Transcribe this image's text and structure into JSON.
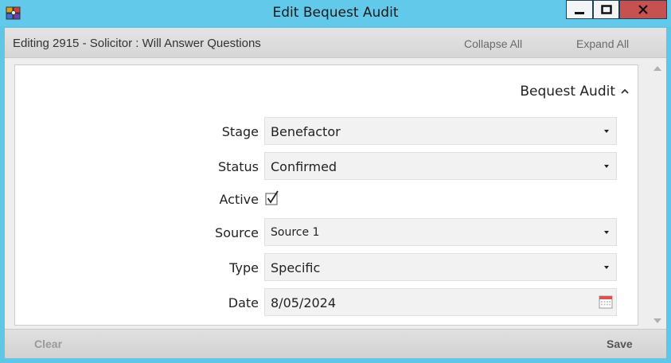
{
  "window": {
    "title": "Edit Bequest Audit",
    "close_color": "#c75050",
    "frame_color": "#62c9ea"
  },
  "header": {
    "title": "Editing 2915 - Solicitor : Will Answer Questions",
    "collapse_all": "Collapse All",
    "expand_all": "Expand All"
  },
  "section": {
    "title": "Bequest Audit",
    "expanded": true
  },
  "form": {
    "stage": {
      "label": "Stage",
      "value": "Benefactor"
    },
    "status": {
      "label": "Status",
      "value": "Confirmed"
    },
    "active": {
      "label": "Active",
      "checked": true
    },
    "source": {
      "label": "Source",
      "value": "Source 1"
    },
    "type": {
      "label": "Type",
      "value": "Specific"
    },
    "date": {
      "label": "Date",
      "value": "8/05/2024"
    }
  },
  "footer": {
    "clear": "Clear",
    "save": "Save"
  }
}
